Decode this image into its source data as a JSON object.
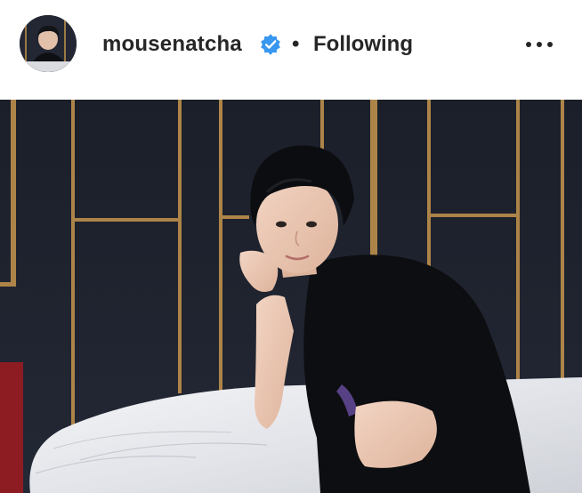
{
  "post": {
    "username": "mousenatcha",
    "separator": "•",
    "follow_state": "Following",
    "verified_icon": "verified-badge-icon",
    "more_icon": "more-options-icon"
  },
  "colors": {
    "verified_blue": "#3897f0",
    "text": "#262626",
    "panel_gold": "#b58a4a",
    "wall_dark": "#1d2230"
  }
}
